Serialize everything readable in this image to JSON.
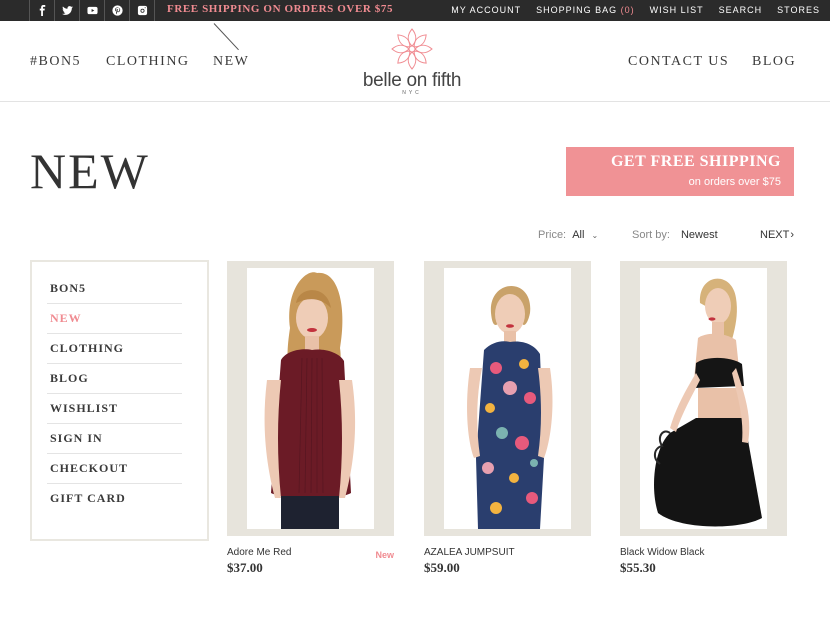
{
  "topbar": {
    "social": [
      {
        "icon": "facebook-icon",
        "glyph": "f"
      },
      {
        "icon": "twitter-icon",
        "glyph": "t"
      },
      {
        "icon": "youtube-icon",
        "glyph": "y"
      },
      {
        "icon": "pinterest-icon",
        "glyph": "p"
      },
      {
        "icon": "instagram-icon",
        "glyph": "i"
      }
    ],
    "promo": "FREE SHIPPING ON ORDERS OVER $75",
    "links": {
      "account": "MY ACCOUNT",
      "bag": "SHOPPING BAG",
      "bag_count": "(0)",
      "wishlist": "WISH LIST",
      "search": "SEARCH",
      "stores": "STORES"
    }
  },
  "nav": {
    "left": [
      "#BON5",
      "CLOTHING",
      "NEW"
    ],
    "right": [
      "CONTACT US",
      "BLOG"
    ]
  },
  "logo": {
    "wordmark": "belle on fifth",
    "sub": "NYC"
  },
  "page_title": "NEW",
  "shipping_banner": {
    "headline": "GET FREE SHIPPING",
    "sub": "on orders over $75"
  },
  "filters": {
    "price_label": "Price:",
    "price_value": "All",
    "sort_label": "Sort by:",
    "sort_value": "Newest",
    "next": "NEXT"
  },
  "sidebar": {
    "items": [
      "BON5",
      "NEW",
      "CLOTHING",
      "BLOG",
      "WISHLIST",
      "SIGN IN",
      "CHECKOUT",
      "GIFT CARD"
    ],
    "active": "NEW"
  },
  "products": [
    {
      "name": "Adore Me Red",
      "price": "$37.00",
      "badge": "New"
    },
    {
      "name": "AZALEA JUMPSUIT",
      "price": "$59.00",
      "badge": ""
    },
    {
      "name": "Black Widow Black",
      "price": "$55.30",
      "badge": ""
    }
  ],
  "colors": {
    "accent": "#f08b91",
    "topbar": "#2b2b2b",
    "frame": "#e7e4dc",
    "banner": "#f09295"
  }
}
